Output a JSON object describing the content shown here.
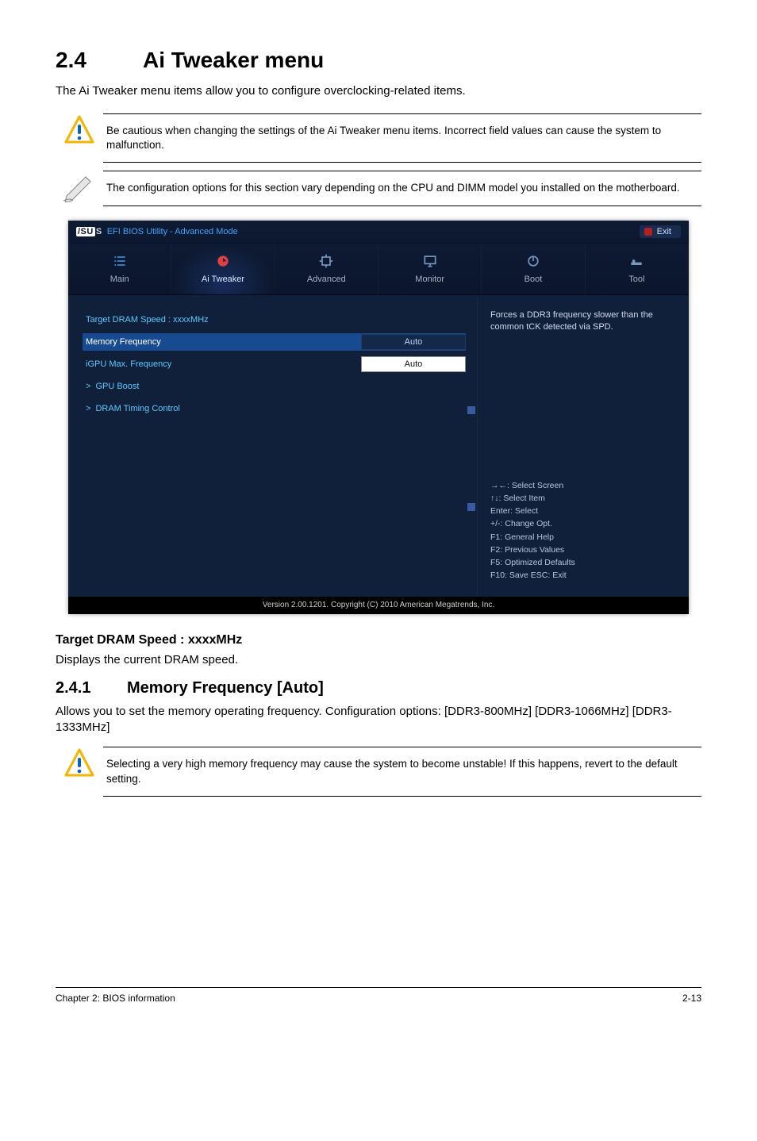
{
  "section": {
    "number": "2.4",
    "title": "Ai Tweaker menu"
  },
  "intro": "The Ai Tweaker menu items allow you to configure overclocking-related items.",
  "warn1": "Be cautious when changing the settings of the Ai Tweaker menu items. Incorrect field values can cause the system to malfunction.",
  "note1": "The configuration options for this section vary depending on the CPU and DIMM model you installed on the motherboard.",
  "bios": {
    "titlebar": {
      "logo_prefix": "/SU",
      "logo_suffix": "S",
      "title": "EFI BIOS Utility - Advanced Mode",
      "exit": "Exit"
    },
    "tabs": {
      "main": "Main",
      "ai": "Ai  Tweaker",
      "advanced": "Advanced",
      "monitor": "Monitor",
      "boot": "Boot",
      "tool": "Tool"
    },
    "fields": {
      "target_label": "Target DRAM Speed : xxxxMHz",
      "memfreq_label": "Memory Frequency",
      "memfreq_value": "Auto",
      "igpu_label": "iGPU Max. Frequency",
      "igpu_value": "Auto",
      "gpuboost_label": "GPU Boost",
      "dramtiming_label": "DRAM Timing Control"
    },
    "help_desc": "Forces a DDR3 frequency slower than the common tCK detected via SPD.",
    "help_keys": {
      "k1": "→←: Select Screen",
      "k2": "↑↓: Select Item",
      "k3": "Enter: Select",
      "k4": "+/-: Change Opt.",
      "k5": "F1: General Help",
      "k6": "F2: Previous Values",
      "k7": "F5: Optimized Defaults",
      "k8": "F10: Save   ESC: Exit"
    },
    "footer": "Version  2.00.1201.   Copyright  (C)  2010  American  Megatrends,  Inc."
  },
  "sub_heading": "Target DRAM Speed : xxxxMHz",
  "sub_text": "Displays the current DRAM speed.",
  "subsection": {
    "number": "2.4.1",
    "title": "Memory Frequency [Auto]"
  },
  "subsection_text": "Allows you to set the memory operating frequency. Configuration options: [DDR3-800MHz] [DDR3-1066MHz] [DDR3-1333MHz]",
  "warn2": "Selecting a very high memory frequency may cause the system to become unstable! If this happens, revert to the default setting.",
  "footer": {
    "left": "Chapter 2: BIOS information",
    "right": "2-13"
  }
}
